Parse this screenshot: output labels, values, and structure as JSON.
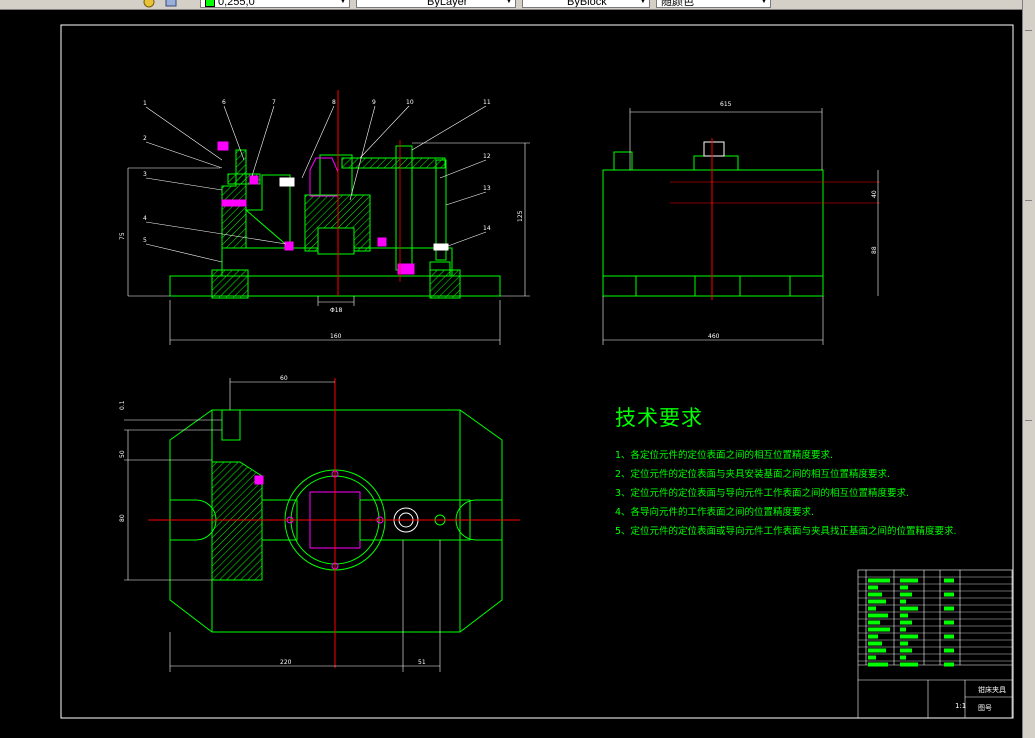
{
  "toolbar": {
    "color_field": "0,255,0",
    "linetype": "ByLayer",
    "lineweight": "ByBlock",
    "plotstyle": "随颜色"
  },
  "tech_requirements": {
    "title": "技术要求",
    "items": [
      "1、各定位元件的定位表面之间的相互位置精度要求.",
      "2、定位元件的定位表面与夹具安装基面之间的相互位置精度要求.",
      "3、定位元件的定位表面与导向元件工作表面之间的相互位置精度要求.",
      "4、各导向元件的工作表面之间的位置精度要求.",
      "5、定位元件的定位表面或导向元件工作表面与夹具找正基面之间的位置精度要求."
    ]
  },
  "title_block": {
    "name": "钳床夹具",
    "drawing_no": "图号",
    "scale": "1:1"
  },
  "dimensions": {
    "front_width": "160",
    "front_height": "75",
    "front_bore": "Φ18",
    "front_total_h": "125",
    "side_top": "615",
    "side_bottom": "460",
    "side_h1": "40",
    "side_h2": "88",
    "plan_width": "220",
    "plan_offset": "51",
    "plan_top": "60",
    "plan_h1": "50",
    "plan_h2": "80",
    "plan_tol": "0.1",
    "balloon_labels": [
      "1",
      "2",
      "3",
      "4",
      "5",
      "6",
      "7",
      "8",
      "9",
      "10",
      "11",
      "12",
      "13",
      "14"
    ]
  },
  "colors": {
    "outline": "#00ff00",
    "centerline": "#ff0000",
    "dimension": "#ffffff",
    "cut_part": "#ff00ff",
    "hatch": "#00ff00"
  }
}
